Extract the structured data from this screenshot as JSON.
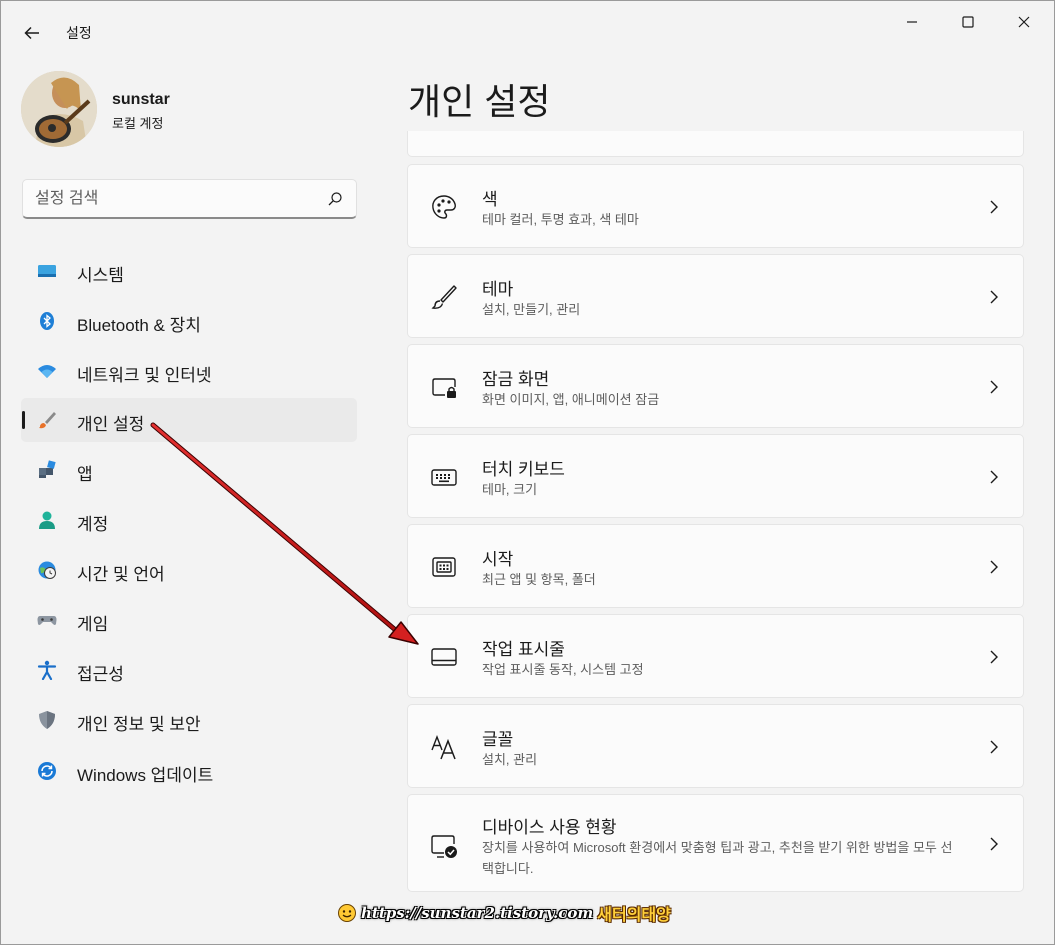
{
  "app": {
    "title": "설정"
  },
  "profile": {
    "name": "sunstar",
    "account_type": "로컬 계정"
  },
  "search": {
    "placeholder": "설정 검색"
  },
  "nav": {
    "items": [
      {
        "label": "시스템",
        "icon": "monitor-icon"
      },
      {
        "label": "Bluetooth & 장치",
        "icon": "bluetooth-icon"
      },
      {
        "label": "네트워크 및 인터넷",
        "icon": "wifi-icon"
      },
      {
        "label": "개인 설정",
        "icon": "paintbrush-icon",
        "active": true
      },
      {
        "label": "앱",
        "icon": "apps-icon"
      },
      {
        "label": "계정",
        "icon": "person-icon"
      },
      {
        "label": "시간 및 언어",
        "icon": "globe-clock-icon"
      },
      {
        "label": "게임",
        "icon": "gamepad-icon"
      },
      {
        "label": "접근성",
        "icon": "accessibility-icon"
      },
      {
        "label": "개인 정보 및 보안",
        "icon": "shield-icon"
      },
      {
        "label": "Windows 업데이트",
        "icon": "update-icon"
      }
    ]
  },
  "main": {
    "title": "개인 설정",
    "cards": [
      {
        "title": "색",
        "subtitle": "테마 컬러, 투명 효과, 색 테마",
        "icon": "palette-icon"
      },
      {
        "title": "테마",
        "subtitle": "설치, 만들기, 관리",
        "icon": "brush-icon"
      },
      {
        "title": "잠금 화면",
        "subtitle": "화면 이미지, 앱, 애니메이션 잠금",
        "icon": "lock-screen-icon"
      },
      {
        "title": "터치 키보드",
        "subtitle": "테마, 크기",
        "icon": "keyboard-icon"
      },
      {
        "title": "시작",
        "subtitle": "최근 앱 및 항목, 폴더",
        "icon": "start-icon"
      },
      {
        "title": "작업 표시줄",
        "subtitle": "작업 표시줄 동작, 시스템 고정",
        "icon": "taskbar-icon"
      },
      {
        "title": "글꼴",
        "subtitle": "설치, 관리",
        "icon": "font-icon"
      },
      {
        "title": "디바이스 사용 현황",
        "subtitle": "장치를 사용하여 Microsoft 환경에서 맞춤형 팁과 광고, 추천을 받기 위한 방법을 모두 선택합니다.",
        "icon": "device-usage-icon"
      }
    ]
  },
  "watermark": {
    "url": "https://sunstar2.tistory.com",
    "blog": "새터의태양"
  },
  "colors": {
    "accent": "#0067c0",
    "arrow": "#d42020",
    "background": "#f3f3f3",
    "card": "#fbfbfb"
  }
}
